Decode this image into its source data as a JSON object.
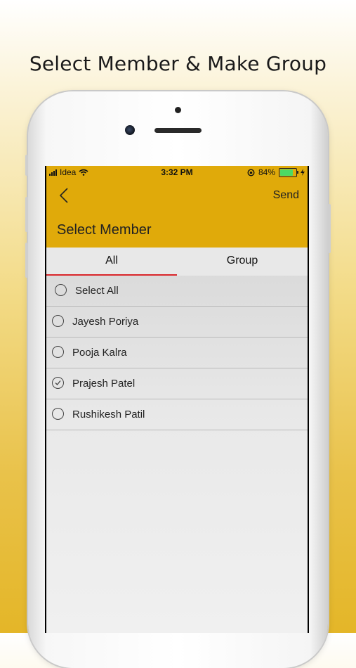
{
  "headline": "Select Member & Make Group",
  "status_bar": {
    "carrier": "Idea",
    "time": "3:32 PM",
    "battery": "84%"
  },
  "header": {
    "title": "Select Member",
    "send_label": "Send"
  },
  "tabs": [
    {
      "label": "All",
      "active": true
    },
    {
      "label": "Group",
      "active": false
    }
  ],
  "select_all": {
    "label": "Select All",
    "checked": false
  },
  "members": [
    {
      "name": "Jayesh Poriya",
      "checked": false
    },
    {
      "name": "Pooja Kalra",
      "checked": false
    },
    {
      "name": "Prajesh Patel",
      "checked": true
    },
    {
      "name": "Rushikesh Patil",
      "checked": false
    }
  ],
  "colors": {
    "accent": "#e0aa0a",
    "tab_indicator": "#d9262b"
  }
}
